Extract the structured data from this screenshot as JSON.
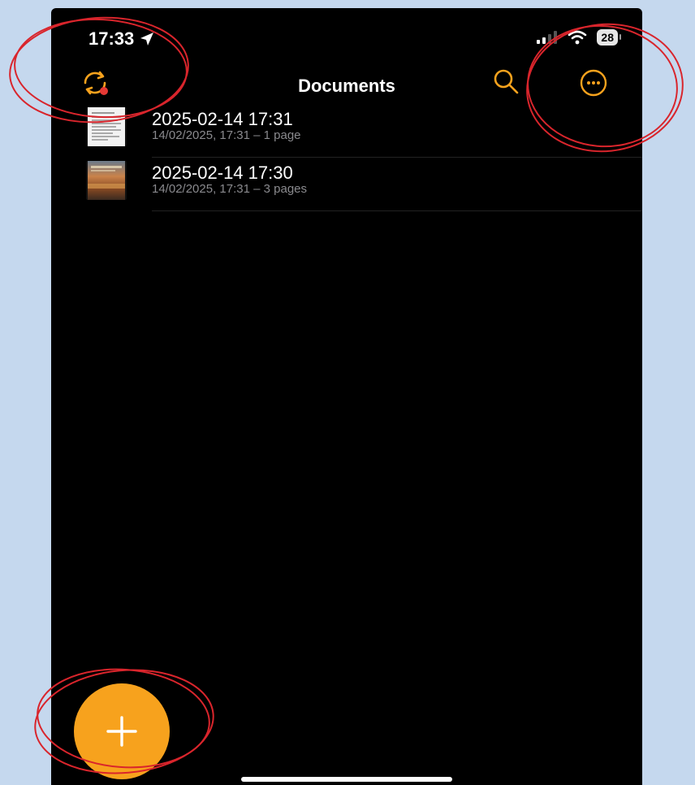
{
  "status_bar": {
    "time": "17:33",
    "battery": "28",
    "icons": [
      "location-arrow-icon",
      "signal-icon",
      "wifi-icon",
      "battery-icon"
    ]
  },
  "nav": {
    "title": "Documents",
    "left_icon": "sync-icon",
    "right_icons": [
      "search-icon",
      "more-icon"
    ]
  },
  "documents": [
    {
      "title": "2025-02-14 17:31",
      "subtitle": "14/02/2025, 17:31 – 1 page",
      "thumbnail": "text-document"
    },
    {
      "title": "2025-02-14 17:30",
      "subtitle": "14/02/2025, 17:31 – 3 pages",
      "thumbnail": "photo-document"
    }
  ],
  "fab": {
    "icon": "plus-icon"
  },
  "colors": {
    "accent": "#f7a21d",
    "background": "#000000",
    "outer_background": "#c5d8ee",
    "annotation": "#d9252c",
    "badge": "#e53935"
  }
}
